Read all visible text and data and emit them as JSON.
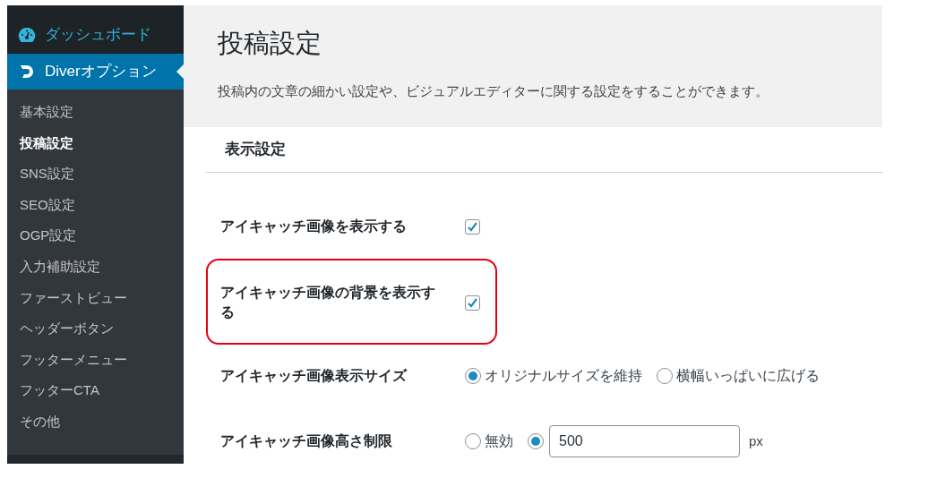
{
  "sidebar": {
    "dashboard": {
      "label": "ダッシュボード"
    },
    "active_menu": {
      "label": "Diverオプション"
    },
    "items": [
      {
        "label": "基本設定",
        "selected": false
      },
      {
        "label": "投稿設定",
        "selected": true
      },
      {
        "label": "SNS設定",
        "selected": false
      },
      {
        "label": "SEO設定",
        "selected": false
      },
      {
        "label": "OGP設定",
        "selected": false
      },
      {
        "label": "入力補助設定",
        "selected": false
      },
      {
        "label": "ファーストビュー",
        "selected": false
      },
      {
        "label": "ヘッダーボタン",
        "selected": false
      },
      {
        "label": "フッターメニュー",
        "selected": false
      },
      {
        "label": "フッターCTA",
        "selected": false
      },
      {
        "label": "その他",
        "selected": false
      }
    ]
  },
  "header": {
    "title": "投稿設定",
    "description": "投稿内の文章の細かい設定や、ビジュアルエディターに関する設定をすることができます。"
  },
  "section": {
    "title": "表示設定"
  },
  "settings": [
    {
      "kind": "checkbox",
      "label": "アイキャッチ画像を表示する",
      "checked": true,
      "highlighted": false
    },
    {
      "kind": "checkbox",
      "label": "アイキャッチ画像の背景を表示する",
      "checked": true,
      "highlighted": true
    },
    {
      "kind": "radio",
      "label": "アイキャッチ画像表示サイズ",
      "highlighted": false,
      "options": [
        {
          "label": "オリジナルサイズを維持",
          "selected": true
        },
        {
          "label": "横幅いっぱいに広げる",
          "selected": false
        }
      ]
    },
    {
      "kind": "radio_input",
      "label": "アイキャッチ画像高さ制限",
      "highlighted": false,
      "options": [
        {
          "label": "無効",
          "selected": false
        },
        {
          "selected": true,
          "value": "500",
          "unit": "px"
        }
      ]
    }
  ]
}
